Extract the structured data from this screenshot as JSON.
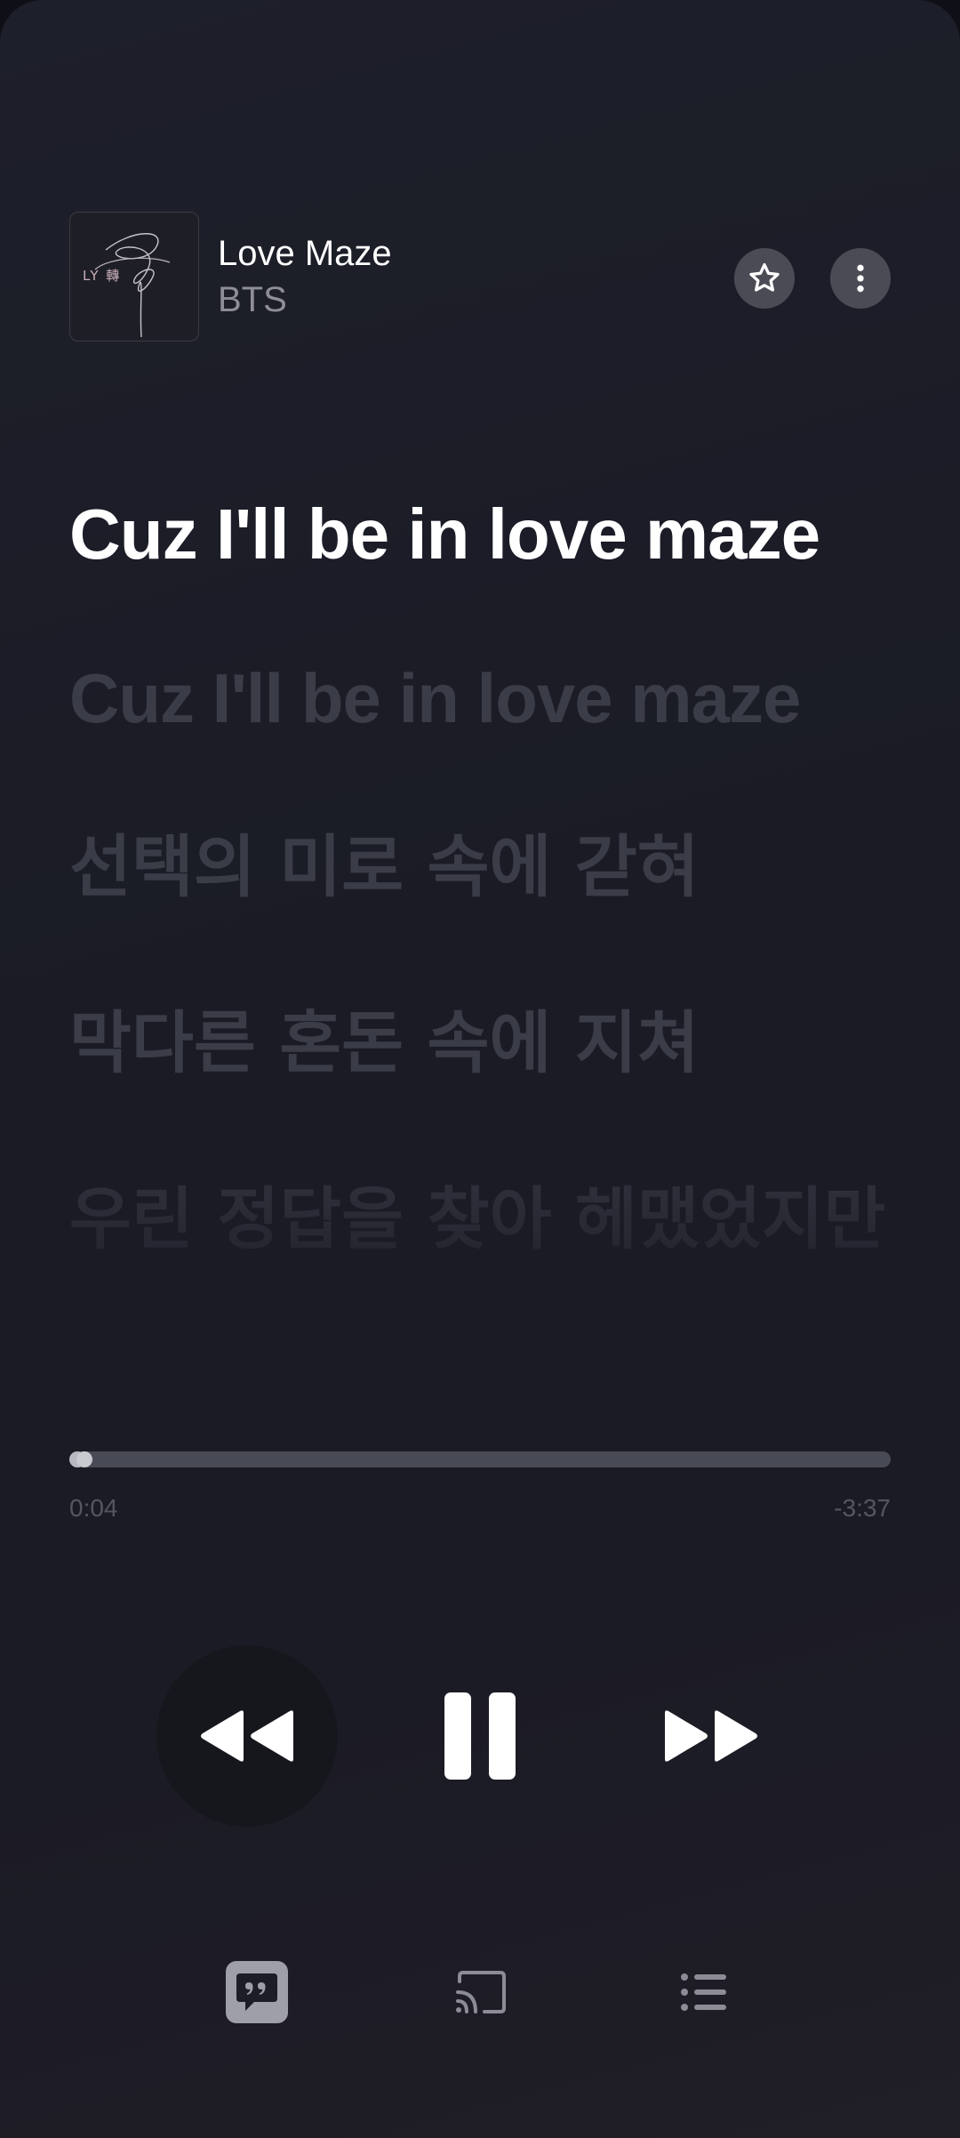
{
  "now_playing": {
    "title": "Love Maze",
    "artist": "BTS",
    "album_art_text": "LY 轉"
  },
  "lyrics": {
    "active": "Cuz I'll be in love maze",
    "upcoming": [
      "Cuz I'll be in love maze",
      "선택의 미로 속에 갇혀",
      "막다른 혼돈 속에 지쳐",
      "우린 정답을 찾아 헤맸었지만"
    ]
  },
  "playback": {
    "elapsed": "0:04",
    "remaining": "-3:37",
    "progress_fraction": 0.018,
    "state": "playing"
  },
  "icons": {
    "favorite": "star-icon",
    "more": "more-vertical-icon",
    "rewind": "rewind-icon",
    "pause": "pause-icon",
    "forward": "fast-forward-icon",
    "lyrics": "lyrics-quote-icon",
    "cast": "cast-icon",
    "queue": "queue-list-icon"
  },
  "colors": {
    "background": "#1b1c26",
    "active_lyric": "#ffffff",
    "inactive_lyric": "#3a3c47",
    "secondary_text": "#8d8e98"
  }
}
